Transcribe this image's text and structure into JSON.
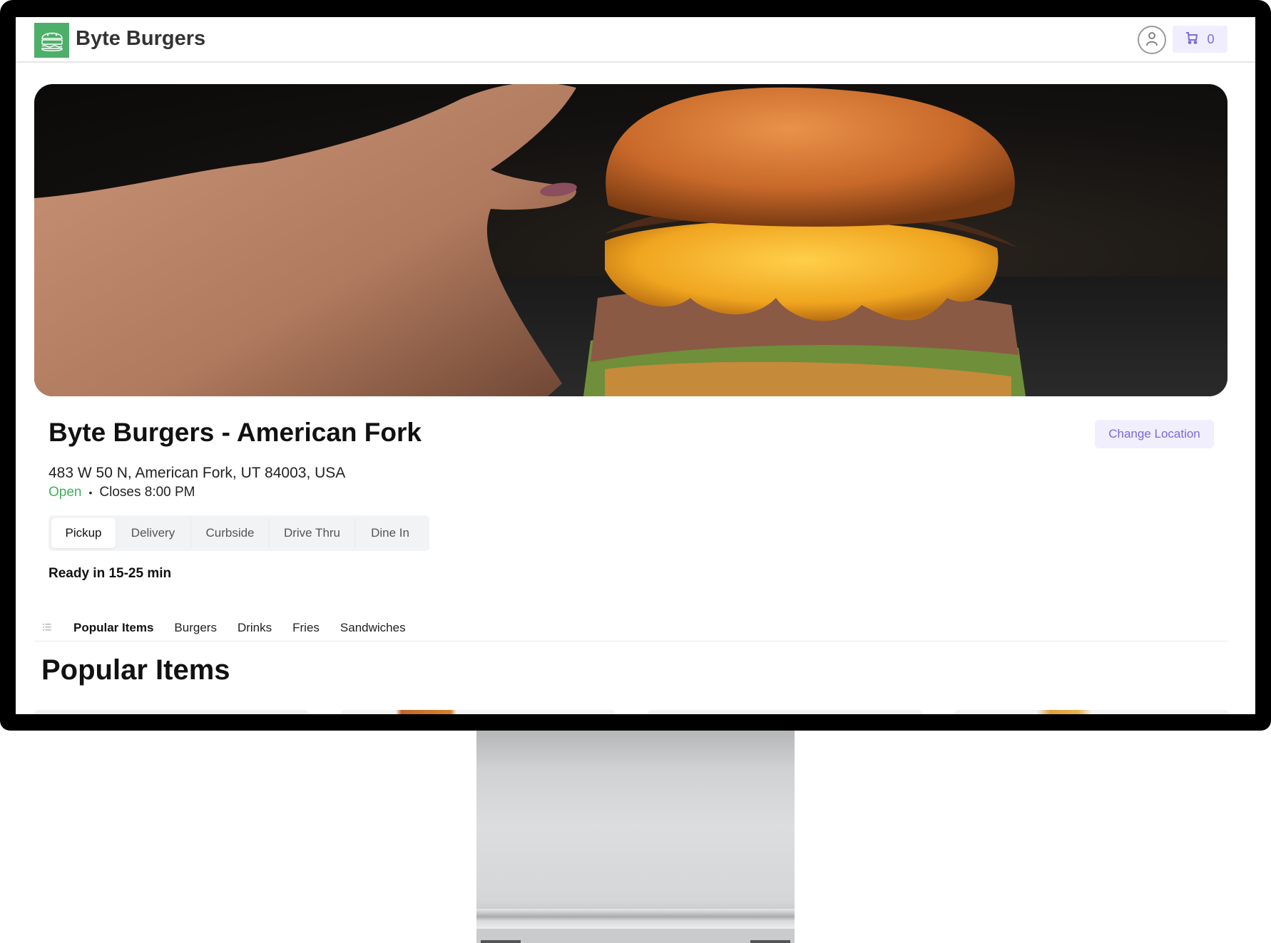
{
  "app": {
    "brand": "Byte Burgers",
    "logo_icon": "burger-logo-icon",
    "accent_color": "#7b6be0",
    "brand_color": "#4caf6a"
  },
  "header": {
    "user_icon": "user-icon",
    "cart_icon": "cart-icon",
    "cart_count": "0"
  },
  "hero": {
    "image_description": "Hand holding a tall cheeseburger with pulled meat, crispy onions and melted cheese"
  },
  "store": {
    "title": "Byte Burgers - American Fork",
    "address": "483 W 50 N, American Fork, UT 84003, USA",
    "status": "Open",
    "status_color": "#3db45a",
    "separator": "•",
    "closes": "Closes 8:00 PM",
    "change_location_label": "Change Location"
  },
  "order_types": {
    "selected": "Pickup",
    "tabs": [
      {
        "label": "Pickup"
      },
      {
        "label": "Delivery"
      },
      {
        "label": "Curbside"
      },
      {
        "label": "Drive Thru"
      },
      {
        "label": "Dine In"
      }
    ]
  },
  "ready_time": "Ready in 15-25 min",
  "categories": {
    "menu_icon": "list-icon",
    "active": "Popular Items",
    "items": [
      {
        "label": "Popular Items"
      },
      {
        "label": "Burgers"
      },
      {
        "label": "Drinks"
      },
      {
        "label": "Fries"
      },
      {
        "label": "Sandwiches"
      }
    ]
  },
  "section": {
    "title": "Popular Items"
  }
}
